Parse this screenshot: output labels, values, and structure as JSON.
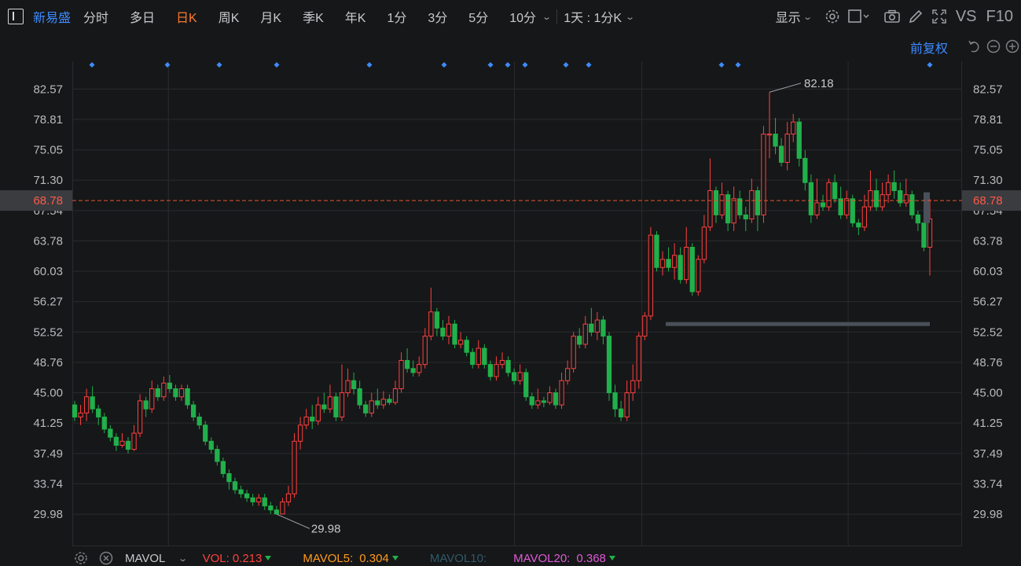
{
  "stock_name": "新易盛",
  "tabs": [
    {
      "label": "分时",
      "active": false
    },
    {
      "label": "多日",
      "active": false
    },
    {
      "label": "日K",
      "active": true
    },
    {
      "label": "周K",
      "active": false
    },
    {
      "label": "月K",
      "active": false
    },
    {
      "label": "季K",
      "active": false
    },
    {
      "label": "年K",
      "active": false
    },
    {
      "label": "1分",
      "active": false
    },
    {
      "label": "3分",
      "active": false
    },
    {
      "label": "5分",
      "active": false
    },
    {
      "label": "10分",
      "active": false
    }
  ],
  "period_selector": "1天 : 1分K",
  "display_label": "显示",
  "vs_label": "VS",
  "f10_label": "F10",
  "adjust_label": "前复权",
  "colors": {
    "up": "#ff4040",
    "down": "#21b04b",
    "price_line": "#e8552e",
    "accent": "#3d8bff",
    "active_tab": "#ff7a2d"
  },
  "chart_data": {
    "type": "candlestick",
    "y_ticks": [
      82.57,
      78.81,
      75.05,
      71.3,
      67.54,
      63.78,
      60.03,
      56.27,
      52.52,
      48.76,
      45.0,
      41.25,
      37.49,
      33.74,
      29.98
    ],
    "y_tick_labels": [
      "82.57",
      "78.81",
      "75.05",
      "71.30",
      "67.54",
      "63.78",
      "60.03",
      "56.27",
      "52.52",
      "48.76",
      "45.00",
      "41.25",
      "37.49",
      "33.74",
      "29.98"
    ],
    "ylim": [
      26.0,
      86.0
    ],
    "current_price": 68.78,
    "current_price_label": "68.78",
    "max_label": "82.18",
    "min_label": "29.98",
    "gap_level": 53.5,
    "markers_count": 15,
    "candles": [
      [
        43.5,
        42.0,
        44.0,
        41.5
      ],
      [
        42.0,
        42.5,
        43.5,
        41.0
      ],
      [
        42.5,
        44.5,
        45.5,
        41.5
      ],
      [
        44.5,
        43.0,
        45.8,
        42.5
      ],
      [
        43.0,
        42.0,
        43.5,
        41.0
      ],
      [
        42.0,
        40.5,
        42.5,
        40.0
      ],
      [
        40.5,
        39.5,
        41.0,
        39.0
      ],
      [
        39.5,
        38.5,
        40.0,
        37.8
      ],
      [
        38.5,
        39.0,
        40.0,
        38.2
      ],
      [
        39.0,
        38.0,
        39.5,
        37.5
      ],
      [
        38.0,
        40.0,
        41.0,
        37.8
      ],
      [
        40.0,
        44.0,
        44.8,
        39.5
      ],
      [
        44.0,
        43.0,
        44.5,
        42.0
      ],
      [
        43.0,
        45.5,
        46.5,
        42.5
      ],
      [
        45.5,
        44.5,
        46.0,
        44.0
      ],
      [
        44.5,
        46.2,
        47.0,
        44.0
      ],
      [
        46.2,
        45.5,
        47.2,
        45.0
      ],
      [
        45.5,
        44.5,
        46.0,
        44.0
      ],
      [
        44.5,
        45.5,
        46.0,
        44.0
      ],
      [
        45.5,
        43.5,
        46.0,
        43.0
      ],
      [
        43.5,
        42.0,
        44.0,
        41.5
      ],
      [
        42.0,
        41.0,
        42.5,
        40.5
      ],
      [
        41.0,
        39.0,
        41.5,
        38.5
      ],
      [
        39.0,
        38.0,
        39.5,
        37.5
      ],
      [
        38.0,
        36.5,
        38.5,
        36.0
      ],
      [
        36.5,
        35.0,
        37.0,
        34.5
      ],
      [
        35.0,
        34.0,
        35.5,
        33.0
      ],
      [
        34.0,
        33.0,
        34.5,
        32.5
      ],
      [
        33.0,
        32.5,
        33.5,
        32.0
      ],
      [
        32.5,
        32.0,
        33.0,
        31.5
      ],
      [
        32.0,
        31.5,
        32.5,
        31.0
      ],
      [
        31.5,
        32.0,
        32.5,
        31.0
      ],
      [
        32.0,
        31.0,
        32.5,
        30.5
      ],
      [
        31.0,
        30.5,
        31.5,
        30.0
      ],
      [
        30.5,
        30.0,
        31.0,
        29.98
      ],
      [
        30.0,
        31.5,
        32.0,
        29.98
      ],
      [
        31.5,
        32.5,
        33.5,
        31.0
      ],
      [
        32.5,
        39.0,
        40.0,
        32.0
      ],
      [
        39.0,
        41.0,
        42.0,
        38.0
      ],
      [
        41.0,
        42.0,
        43.0,
        40.5
      ],
      [
        42.0,
        41.5,
        43.5,
        40.5
      ],
      [
        41.5,
        43.5,
        44.5,
        41.0
      ],
      [
        43.5,
        43.0,
        45.0,
        42.5
      ],
      [
        43.0,
        44.5,
        46.0,
        42.5
      ],
      [
        44.5,
        42.0,
        45.0,
        41.5
      ],
      [
        42.0,
        45.0,
        48.5,
        41.5
      ],
      [
        45.0,
        46.5,
        48.0,
        44.5
      ],
      [
        46.5,
        45.5,
        47.5,
        44.8
      ],
      [
        45.5,
        43.5,
        46.5,
        43.0
      ],
      [
        43.5,
        42.5,
        44.0,
        42.0
      ],
      [
        42.5,
        44.0,
        45.0,
        42.0
      ],
      [
        44.0,
        43.5,
        45.5,
        43.0
      ],
      [
        43.5,
        44.2,
        45.2,
        43.0
      ],
      [
        44.2,
        43.8,
        44.8,
        43.5
      ],
      [
        43.8,
        45.5,
        46.5,
        43.5
      ],
      [
        45.5,
        49.0,
        50.0,
        45.0
      ],
      [
        49.0,
        48.0,
        50.5,
        47.5
      ],
      [
        48.0,
        47.5,
        49.0,
        47.0
      ],
      [
        47.5,
        48.5,
        49.5,
        47.0
      ],
      [
        48.5,
        52.0,
        53.0,
        48.0
      ],
      [
        52.0,
        55.0,
        58.0,
        51.5
      ],
      [
        55.0,
        53.0,
        55.5,
        52.0
      ],
      [
        53.0,
        52.0,
        54.0,
        51.5
      ],
      [
        52.0,
        53.5,
        54.5,
        51.0
      ],
      [
        53.5,
        51.0,
        54.0,
        50.5
      ],
      [
        51.0,
        51.5,
        52.5,
        50.5
      ],
      [
        51.5,
        50.0,
        52.0,
        49.5
      ],
      [
        50.0,
        48.5,
        50.5,
        48.0
      ],
      [
        48.5,
        50.5,
        51.5,
        48.0
      ],
      [
        50.5,
        48.5,
        51.0,
        48.0
      ],
      [
        48.5,
        47.0,
        49.0,
        46.5
      ],
      [
        47.0,
        48.5,
        49.5,
        46.5
      ],
      [
        48.5,
        49.0,
        50.0,
        48.0
      ],
      [
        49.0,
        47.5,
        49.5,
        47.0
      ],
      [
        47.5,
        46.5,
        48.0,
        46.0
      ],
      [
        46.5,
        47.5,
        48.5,
        46.0
      ],
      [
        47.5,
        44.5,
        48.0,
        44.0
      ],
      [
        44.5,
        43.5,
        45.0,
        43.0
      ],
      [
        43.5,
        44.0,
        45.5,
        43.0
      ],
      [
        44.0,
        43.8,
        44.5,
        43.2
      ],
      [
        43.8,
        45.0,
        45.8,
        43.5
      ],
      [
        45.0,
        43.5,
        45.5,
        43.0
      ],
      [
        43.5,
        46.5,
        47.5,
        43.0
      ],
      [
        46.5,
        48.0,
        49.0,
        46.0
      ],
      [
        48.0,
        52.0,
        52.5,
        47.5
      ],
      [
        52.0,
        51.0,
        53.0,
        50.5
      ],
      [
        51.0,
        53.5,
        54.5,
        50.5
      ],
      [
        53.5,
        52.5,
        55.5,
        52.0
      ],
      [
        52.5,
        54.0,
        55.0,
        51.5
      ],
      [
        54.0,
        52.0,
        54.5,
        51.0
      ],
      [
        52.0,
        45.0,
        52.5,
        44.0
      ],
      [
        45.0,
        43.0,
        46.0,
        42.0
      ],
      [
        43.0,
        42.0,
        44.0,
        41.5
      ],
      [
        42.0,
        45.0,
        46.5,
        41.5
      ],
      [
        45.0,
        46.5,
        48.5,
        44.0
      ],
      [
        46.5,
        52.0,
        52.5,
        45.5
      ],
      [
        52.0,
        54.5,
        55.0,
        51.5
      ],
      [
        54.5,
        64.5,
        65.5,
        54.0
      ],
      [
        64.5,
        60.5,
        65.0,
        60.0
      ],
      [
        60.5,
        61.5,
        62.5,
        59.5
      ],
      [
        61.5,
        60.5,
        63.0,
        60.0
      ],
      [
        60.5,
        62.0,
        63.5,
        59.0
      ],
      [
        62.0,
        59.0,
        63.0,
        58.5
      ],
      [
        59.0,
        63.0,
        65.5,
        58.5
      ],
      [
        63.0,
        57.5,
        63.5,
        57.0
      ],
      [
        57.5,
        61.5,
        62.0,
        57.0
      ],
      [
        61.5,
        65.5,
        67.0,
        61.0
      ],
      [
        65.5,
        70.0,
        74.0,
        65.0
      ],
      [
        70.0,
        67.0,
        70.5,
        66.0
      ],
      [
        67.0,
        69.5,
        71.0,
        66.5
      ],
      [
        69.5,
        66.0,
        70.0,
        65.0
      ],
      [
        66.0,
        69.0,
        70.5,
        65.0
      ],
      [
        69.0,
        67.0,
        70.0,
        66.5
      ],
      [
        67.0,
        66.5,
        68.0,
        65.0
      ],
      [
        66.5,
        70.0,
        71.5,
        66.0
      ],
      [
        70.0,
        67.0,
        70.5,
        65.0
      ],
      [
        67.0,
        77.0,
        78.0,
        66.0
      ],
      [
        77.0,
        77.0,
        82.18,
        74.0
      ],
      [
        77.0,
        75.5,
        79.0,
        74.5
      ],
      [
        75.5,
        73.5,
        76.5,
        73.0
      ],
      [
        73.5,
        77.0,
        78.5,
        72.5
      ],
      [
        77.0,
        78.5,
        79.5,
        76.0
      ],
      [
        78.5,
        74.0,
        79.0,
        73.0
      ],
      [
        74.0,
        71.0,
        75.0,
        70.0
      ],
      [
        71.0,
        67.0,
        72.0,
        66.0
      ],
      [
        67.0,
        68.5,
        71.5,
        66.5
      ],
      [
        68.5,
        68.0,
        69.5,
        67.5
      ],
      [
        68.0,
        71.0,
        71.5,
        67.5
      ],
      [
        71.0,
        69.0,
        72.0,
        68.5
      ],
      [
        69.0,
        67.0,
        70.5,
        66.5
      ],
      [
        67.0,
        69.0,
        70.0,
        66.5
      ],
      [
        69.0,
        66.0,
        69.5,
        65.5
      ],
      [
        66.0,
        65.5,
        66.5,
        64.5
      ],
      [
        65.5,
        68.0,
        69.5,
        65.0
      ],
      [
        68.0,
        70.0,
        72.5,
        67.5
      ],
      [
        70.0,
        68.0,
        71.5,
        67.5
      ],
      [
        68.0,
        69.5,
        71.0,
        67.5
      ],
      [
        69.5,
        71.0,
        72.0,
        68.5
      ],
      [
        71.0,
        70.0,
        72.5,
        69.0
      ],
      [
        70.0,
        68.5,
        71.0,
        68.0
      ],
      [
        68.5,
        69.5,
        71.5,
        68.0
      ],
      [
        69.5,
        67.0,
        70.0,
        66.5
      ],
      [
        67.0,
        66.0,
        67.5,
        65.0
      ],
      [
        66.0,
        63.0,
        66.5,
        62.5
      ],
      [
        63.0,
        66.5,
        69.0,
        59.5
      ]
    ]
  },
  "bottom": {
    "mavol": "MAVOL",
    "vol_label": "VOL:",
    "vol_value": "0.213",
    "mavol5_label": "MAVOL5:",
    "mavol5_value": "0.304",
    "mavol10_label": "MAVOL10:",
    "mavol20_label": "MAVOL20:",
    "mavol20_value": "0.368"
  }
}
